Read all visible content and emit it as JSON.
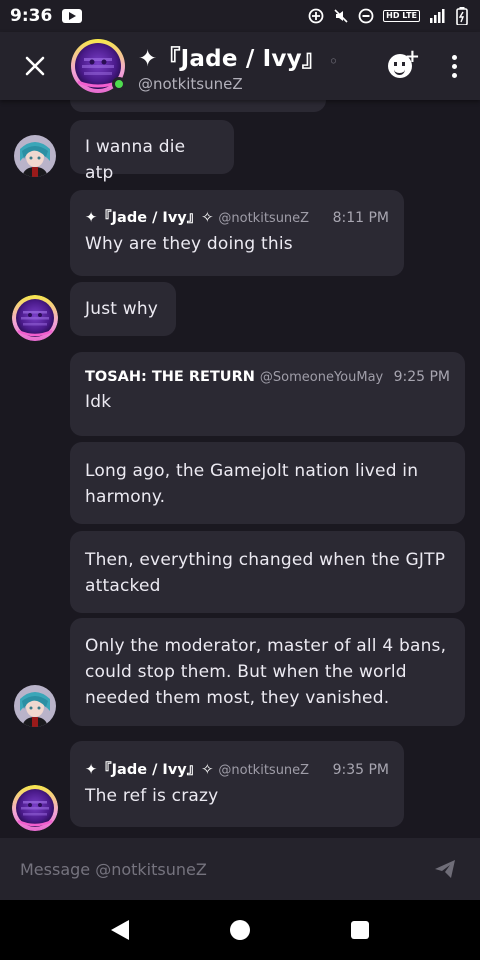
{
  "status_bar": {
    "time": "9:36",
    "network": "HD LTE"
  },
  "header": {
    "close_label": "✕",
    "display_name": "✦『Jade / Ivy』",
    "name_fade": "◦",
    "handle": "@notkitsuneZ"
  },
  "messages": [
    {
      "id": "m1",
      "text": "I wanna die atp"
    },
    {
      "id": "m2",
      "author": "✦『Jade / Ivy』✧",
      "handle": "@notkitsuneZ",
      "time": "8:11 PM",
      "text": "Why are they doing this"
    },
    {
      "id": "m3",
      "text": "Just why"
    },
    {
      "id": "m4",
      "author": "TOSAH: THE RETURN",
      "handle": "@SomeoneYouMay",
      "time": "9:25 PM",
      "text": "Idk"
    },
    {
      "id": "m5",
      "text": "Long ago, the Gamejolt nation lived in harmony."
    },
    {
      "id": "m6",
      "text": "Then, everything changed when the GJTP attacked"
    },
    {
      "id": "m7",
      "text": "Only the moderator, master of all 4 bans, could stop them. But when the world needed them most, they vanished."
    },
    {
      "id": "m8",
      "author": "✦『Jade / Ivy』✧",
      "handle": "@notkitsuneZ",
      "time": "9:35 PM",
      "text": "The ref is crazy"
    }
  ],
  "composer": {
    "placeholder": "Message @notkitsuneZ"
  },
  "colors": {
    "background": "#1a1820",
    "bubble": "#2b2933",
    "header": "#25232c",
    "online": "#4fdc4f",
    "avatar_ring": "#e9e04a"
  },
  "icons": [
    "close-icon",
    "add-friend-icon",
    "more-vert-icon",
    "send-icon",
    "nav-back-icon",
    "nav-home-icon",
    "nav-recents-icon"
  ]
}
